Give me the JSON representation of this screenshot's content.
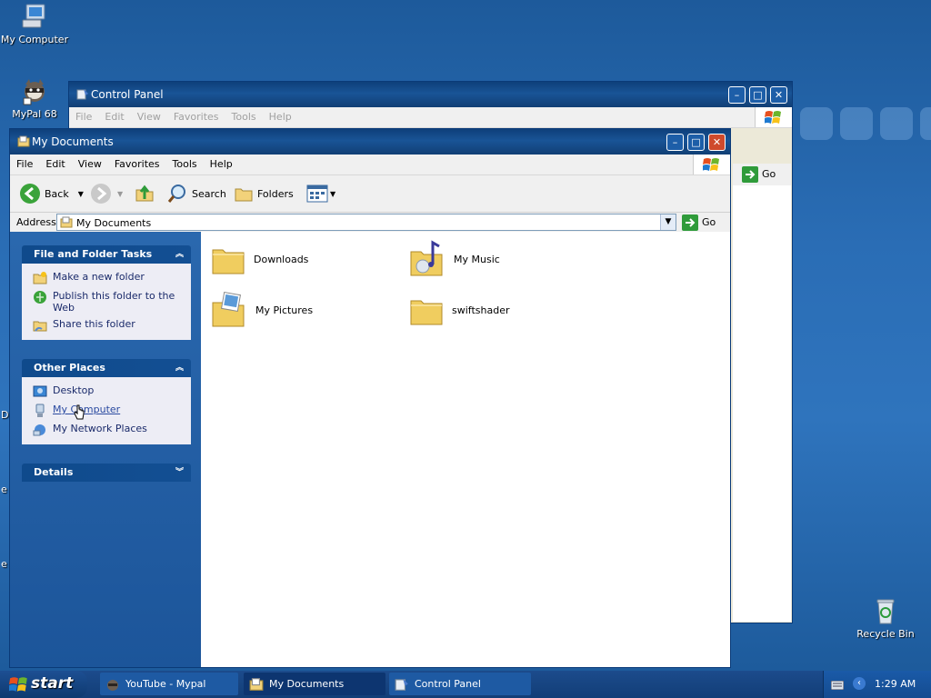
{
  "desktop": {
    "icons": [
      {
        "label": "My Computer",
        "icon": "my-computer-icon"
      },
      {
        "label": "MyPal 68",
        "icon": "mypal-icon"
      },
      {
        "label": "Recycle Bin",
        "icon": "recycle-bin-icon"
      }
    ],
    "edge_letters": [
      "D",
      "e",
      "e"
    ]
  },
  "control_panel": {
    "title": "Control Panel",
    "menu": [
      "File",
      "Edit",
      "View",
      "Favorites",
      "Tools",
      "Help"
    ],
    "go_label": "Go"
  },
  "my_documents": {
    "title": "My Documents",
    "menu": [
      "File",
      "Edit",
      "View",
      "Favorites",
      "Tools",
      "Help"
    ],
    "toolbar": {
      "back": "Back",
      "search": "Search",
      "folders": "Folders"
    },
    "address": {
      "label": "Address",
      "value": "My Documents",
      "go": "Go"
    },
    "tasks": [
      {
        "header": "File and Folder Tasks",
        "items": [
          {
            "label": "Make a new folder",
            "icon": "new-folder-icon"
          },
          {
            "label": "Publish this folder to the Web",
            "icon": "publish-web-icon"
          },
          {
            "label": "Share this folder",
            "icon": "share-folder-icon"
          }
        ]
      },
      {
        "header": "Other Places",
        "items": [
          {
            "label": "Desktop",
            "icon": "desktop-icon"
          },
          {
            "label": "My Computer",
            "icon": "my-computer-icon"
          },
          {
            "label": "My Network Places",
            "icon": "network-places-icon"
          }
        ]
      },
      {
        "header": "Details",
        "items": []
      }
    ],
    "files": [
      {
        "label": "Downloads",
        "icon": "folder-icon"
      },
      {
        "label": "My Music",
        "icon": "music-folder-icon"
      },
      {
        "label": "My Pictures",
        "icon": "pictures-folder-icon"
      },
      {
        "label": "swiftshader",
        "icon": "folder-icon"
      }
    ]
  },
  "taskbar": {
    "start": "start",
    "tasks": [
      {
        "label": "YouTube - Mypal",
        "active": false
      },
      {
        "label": "My Documents",
        "active": true
      },
      {
        "label": "Control Panel",
        "active": false
      }
    ],
    "clock": "1:29 AM"
  }
}
